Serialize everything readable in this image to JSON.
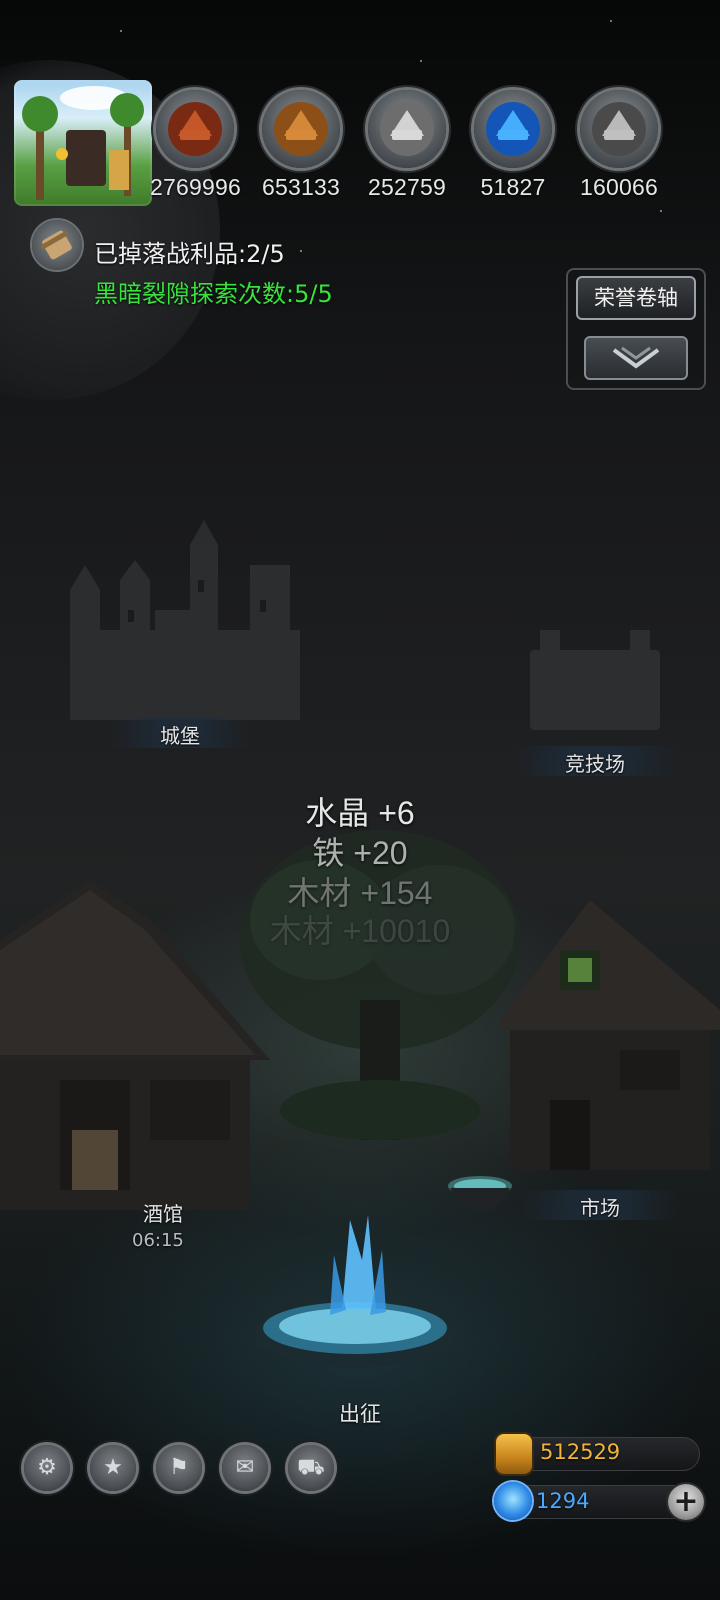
{
  "resources": [
    {
      "icon": "meat-icon",
      "value": "2769996"
    },
    {
      "icon": "wood-planks-icon",
      "value": "653133"
    },
    {
      "icon": "stone-blocks-icon",
      "value": "252759"
    },
    {
      "icon": "crystal-icon",
      "value": "51827"
    },
    {
      "icon": "iron-ingots-icon",
      "value": "160066"
    }
  ],
  "quest": {
    "loot": "已掉落战利品:2/5",
    "rift": "黑暗裂隙探索次数:5/5"
  },
  "honor_scroll": {
    "label": "荣誉卷轴"
  },
  "buildings": {
    "castle": "城堡",
    "arena": "竞技场",
    "tavern": "酒馆",
    "tavern_timer": "06:15",
    "market": "市场",
    "expedition": "出征"
  },
  "rewards": [
    {
      "text": "水晶 +6",
      "color": "#e6e6e6",
      "opacity": 1.0
    },
    {
      "text": "铁 +20",
      "color": "#c9c9c9",
      "opacity": 0.85
    },
    {
      "text": "木材 +154",
      "color": "#a3a3a3",
      "opacity": 0.6
    },
    {
      "text": "木材 +10010",
      "color": "#7b7b7b",
      "opacity": 0.3
    }
  ],
  "dock": [
    "settings-gear-icon",
    "achievement-star-icon",
    "banner-icon",
    "mail-icon",
    "cart-icon"
  ],
  "currency": {
    "gold": "512529",
    "gems": "1294"
  },
  "colors": {
    "rift_green": "#38e33b",
    "gold_text": "#f1b43a",
    "gem_text": "#4aa8ff"
  }
}
